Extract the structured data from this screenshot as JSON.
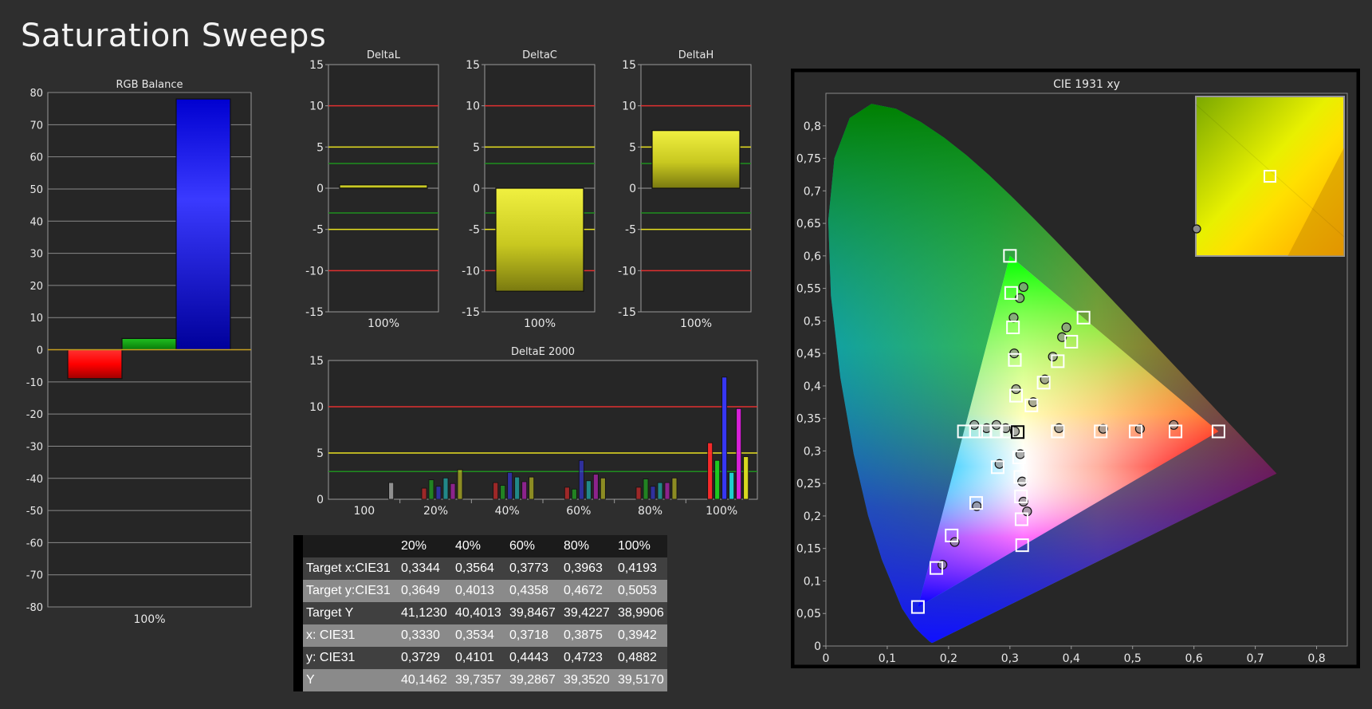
{
  "page": {
    "title": "Saturation Sweeps"
  },
  "colors": {
    "background": "#2e2e2e",
    "plot_background": "#262626",
    "red_limit": "#e03030",
    "yellow_limit": "#e8e020",
    "green_limit": "#1f8f1f"
  },
  "chart_data": [
    {
      "id": "rgb_balance",
      "type": "bar",
      "title": "RGB Balance",
      "categories": [
        "100%"
      ],
      "series": [
        {
          "color": "#ff1010",
          "values": [
            -9
          ]
        },
        {
          "color": "#12a012",
          "values": [
            3.5
          ]
        },
        {
          "color": "#1a1aff",
          "values": [
            78
          ]
        }
      ],
      "ylim": [
        -80,
        80
      ],
      "yticks": [
        80,
        70,
        60,
        50,
        40,
        30,
        20,
        10,
        0,
        -10,
        -20,
        -30,
        -40,
        -50,
        -60,
        -70,
        -80
      ],
      "grid": true
    },
    {
      "id": "delta_l",
      "type": "bar",
      "title": "DeltaL",
      "categories": [
        "100%"
      ],
      "values": [
        0.4
      ],
      "ylim": [
        -15,
        15
      ],
      "yticks": [
        15,
        10,
        5,
        0,
        -5,
        -10,
        -15
      ],
      "reference_lines": [
        10,
        5,
        3,
        -3,
        -5,
        -10
      ]
    },
    {
      "id": "delta_c",
      "type": "bar",
      "title": "DeltaC",
      "categories": [
        "100%"
      ],
      "values": [
        -12.5
      ],
      "ylim": [
        -15,
        15
      ],
      "yticks": [
        15,
        10,
        5,
        0,
        -5,
        -10,
        -15
      ],
      "reference_lines": [
        10,
        5,
        3,
        -3,
        -5,
        -10
      ]
    },
    {
      "id": "delta_h",
      "type": "bar",
      "title": "DeltaH",
      "categories": [
        "100%"
      ],
      "values": [
        7
      ],
      "ylim": [
        -15,
        15
      ],
      "yticks": [
        15,
        10,
        5,
        0,
        -5,
        -10,
        -15
      ],
      "reference_lines": [
        10,
        5,
        3,
        -3,
        -5,
        -10
      ]
    },
    {
      "id": "delta_e_2000",
      "type": "bar",
      "title": "DeltaE 2000",
      "categories": [
        "100",
        "20%",
        "40%",
        "60%",
        "80%",
        "100%"
      ],
      "series_colors": [
        "#ff2a2a",
        "#1fd01f",
        "#3838ff",
        "#1fd8d8",
        "#e020e0",
        "#e0e020"
      ],
      "groups": [
        {
          "label": "100",
          "values": [
            1.8
          ]
        },
        {
          "label": "20%",
          "values": [
            1.2,
            2.1,
            1.4,
            2.3,
            1.7,
            3.2
          ]
        },
        {
          "label": "40%",
          "values": [
            1.8,
            1.5,
            2.9,
            2.4,
            1.9,
            2.4
          ]
        },
        {
          "label": "60%",
          "values": [
            1.3,
            1.1,
            4.2,
            2.0,
            2.7,
            2.3
          ]
        },
        {
          "label": "80%",
          "values": [
            1.3,
            2.2,
            1.4,
            1.8,
            1.8,
            2.3
          ]
        },
        {
          "label": "100%",
          "values": [
            6.1,
            4.2,
            13.2,
            2.9,
            9.8,
            4.6
          ]
        }
      ],
      "ylim": [
        0,
        15
      ],
      "yticks": [
        15,
        10,
        5,
        0
      ],
      "reference_lines": [
        10,
        5,
        3
      ]
    },
    {
      "id": "cie_1931",
      "type": "scatter",
      "title": "CIE 1931 xy",
      "xlim": [
        0,
        0.85
      ],
      "ylim": [
        0,
        0.85
      ],
      "xticks": [
        "0",
        "0,1",
        "0,2",
        "0,3",
        "0,4",
        "0,5",
        "0,6",
        "0,7",
        "0,8"
      ],
      "yticks": [
        "0",
        "0,05",
        "0,1",
        "0,15",
        "0,2",
        "0,25",
        "0,3",
        "0,35",
        "0,4",
        "0,45",
        "0,5",
        "0,55",
        "0,6",
        "0,65",
        "0,7",
        "0,75",
        "0,8"
      ],
      "gamut_triangle": [
        [
          0.64,
          0.33
        ],
        [
          0.3,
          0.6
        ],
        [
          0.15,
          0.06
        ]
      ],
      "white_point": [
        0.3127,
        0.329
      ],
      "targets": [
        [
          0.64,
          0.33
        ],
        [
          0.57,
          0.33
        ],
        [
          0.505,
          0.33
        ],
        [
          0.448,
          0.33
        ],
        [
          0.378,
          0.33
        ],
        [
          0.3,
          0.6
        ],
        [
          0.302,
          0.543
        ],
        [
          0.305,
          0.49
        ],
        [
          0.308,
          0.44
        ],
        [
          0.31,
          0.385
        ],
        [
          0.15,
          0.06
        ],
        [
          0.18,
          0.12
        ],
        [
          0.205,
          0.17
        ],
        [
          0.245,
          0.22
        ],
        [
          0.28,
          0.275
        ],
        [
          0.42,
          0.505
        ],
        [
          0.4,
          0.468
        ],
        [
          0.378,
          0.438
        ],
        [
          0.355,
          0.405
        ],
        [
          0.335,
          0.37
        ],
        [
          0.225,
          0.33
        ],
        [
          0.245,
          0.33
        ],
        [
          0.26,
          0.33
        ],
        [
          0.278,
          0.33
        ],
        [
          0.295,
          0.33
        ],
        [
          0.32,
          0.155
        ],
        [
          0.319,
          0.195
        ],
        [
          0.318,
          0.23
        ],
        [
          0.317,
          0.26
        ],
        [
          0.315,
          0.29
        ],
        [
          0.3127,
          0.329
        ]
      ],
      "measured": [
        [
          0.567,
          0.34
        ],
        [
          0.512,
          0.334
        ],
        [
          0.452,
          0.334
        ],
        [
          0.38,
          0.335
        ],
        [
          0.322,
          0.552
        ],
        [
          0.316,
          0.535
        ],
        [
          0.306,
          0.505
        ],
        [
          0.307,
          0.45
        ],
        [
          0.31,
          0.395
        ],
        [
          0.385,
          0.475
        ],
        [
          0.392,
          0.49
        ],
        [
          0.37,
          0.445
        ],
        [
          0.357,
          0.41
        ],
        [
          0.338,
          0.375
        ],
        [
          0.242,
          0.34
        ],
        [
          0.262,
          0.335
        ],
        [
          0.278,
          0.34
        ],
        [
          0.293,
          0.335
        ],
        [
          0.328,
          0.207
        ],
        [
          0.322,
          0.222
        ],
        [
          0.32,
          0.253
        ],
        [
          0.317,
          0.295
        ],
        [
          0.308,
          0.33
        ],
        [
          0.283,
          0.28
        ],
        [
          0.246,
          0.215
        ],
        [
          0.21,
          0.16
        ],
        [
          0.19,
          0.125
        ]
      ],
      "inset_target": [
        0.42,
        0.505
      ],
      "inset_measured": [
        0.392,
        0.49
      ]
    }
  ],
  "table": {
    "headers": [
      "",
      "20%",
      "40%",
      "60%",
      "80%",
      "100%"
    ],
    "rows": [
      {
        "label": "Target x:CIE31",
        "values": [
          "0,3344",
          "0,3564",
          "0,3773",
          "0,3963",
          "0,4193"
        ]
      },
      {
        "label": "Target y:CIE31",
        "values": [
          "0,3649",
          "0,4013",
          "0,4358",
          "0,4672",
          "0,5053"
        ]
      },
      {
        "label": "Target Y",
        "values": [
          "41,1230",
          "40,4013",
          "39,8467",
          "39,4227",
          "38,9906"
        ]
      },
      {
        "label": "x: CIE31",
        "values": [
          "0,3330",
          "0,3534",
          "0,3718",
          "0,3875",
          "0,3942"
        ]
      },
      {
        "label": "y: CIE31",
        "values": [
          "0,3729",
          "0,4101",
          "0,4443",
          "0,4723",
          "0,4882"
        ]
      },
      {
        "label": "Y",
        "values": [
          "40,1462",
          "39,7357",
          "39,2867",
          "39,3520",
          "39,5170"
        ]
      }
    ]
  }
}
